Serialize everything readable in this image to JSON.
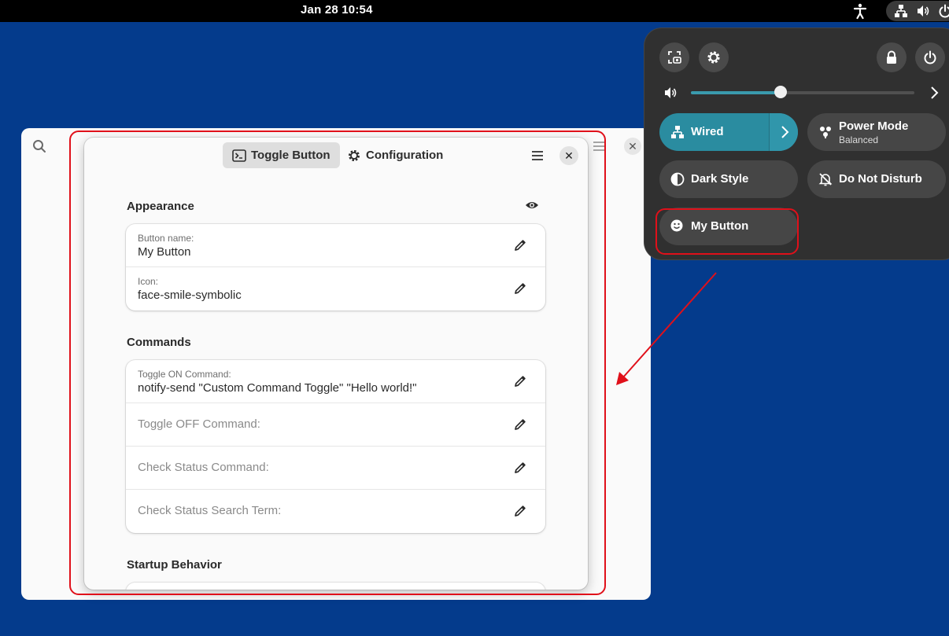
{
  "topbar": {
    "clock": "Jan 28  10:54",
    "icons": [
      "accessibility-icon",
      "network-wired-icon",
      "volume-icon",
      "power-icon"
    ]
  },
  "back_window": {
    "icons": [
      "search-icon",
      "menu-icon",
      "close-icon"
    ],
    "close_glyph": "✕"
  },
  "dialog": {
    "tabs": [
      {
        "label": "Toggle Button",
        "icon": "terminal-icon",
        "selected": true
      },
      {
        "label": "Configuration",
        "icon": "gear-icon",
        "selected": false
      }
    ],
    "close_glyph": "✕",
    "sections": {
      "appearance": {
        "title": "Appearance",
        "rows": [
          {
            "label": "Button name:",
            "value": "My Button"
          },
          {
            "label": "Icon:",
            "value": "face-smile-symbolic"
          }
        ]
      },
      "commands": {
        "title": "Commands",
        "rows": [
          {
            "label": "Toggle ON Command:",
            "value": "notify-send \"Custom Command Toggle\" \"Hello world!\""
          },
          {
            "placeholder": "Toggle OFF Command:"
          },
          {
            "placeholder": "Check Status Command:"
          },
          {
            "placeholder": "Check Status Search Term:"
          }
        ]
      },
      "startup": {
        "title": "Startup Behavior"
      }
    }
  },
  "quick_settings": {
    "volume_level": 0.4,
    "tiles": {
      "wired": {
        "label": "Wired",
        "active": true
      },
      "power_mode": {
        "label": "Power Mode",
        "subtitle": "Balanced"
      },
      "dark_style": {
        "label": "Dark Style"
      },
      "dnd": {
        "label": "Do Not Disturb"
      },
      "my_button": {
        "label": "My Button"
      }
    }
  },
  "colors": {
    "desktop": "#043b8c",
    "accent": "#2a8ca0",
    "annotation": "#e0101a"
  }
}
